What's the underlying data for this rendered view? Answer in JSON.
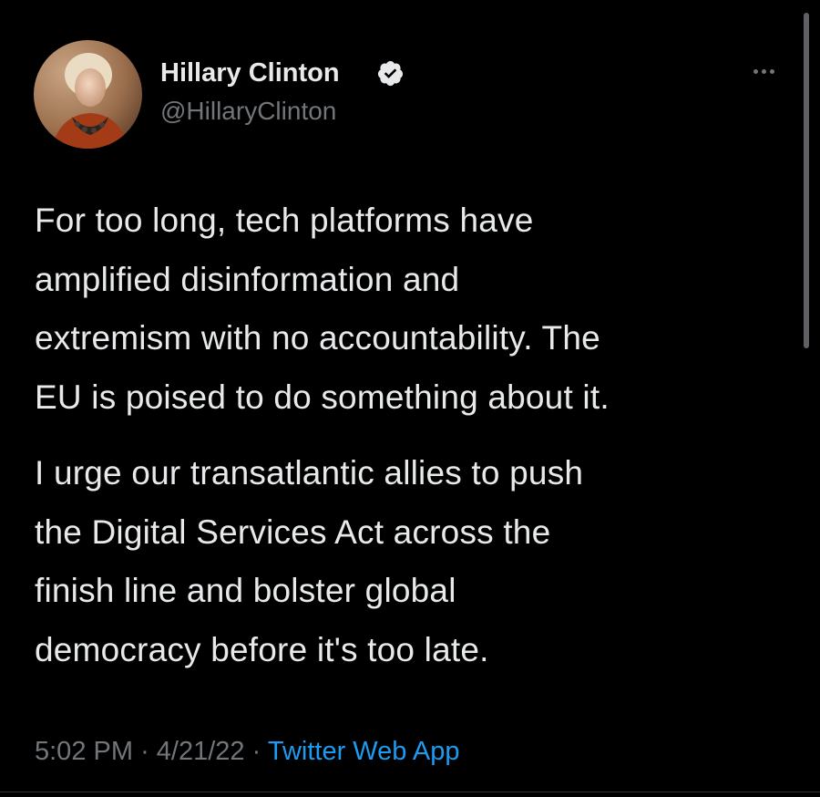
{
  "tweet": {
    "author": {
      "name": "Hillary Clinton",
      "handle": "@HillaryClinton",
      "verified": true
    },
    "paragraphs": [
      [
        "For too long, tech platforms have",
        "amplified disinformation and",
        "extremism with no accountability. The",
        "EU is poised to do something about it."
      ],
      [
        "I urge our transatlantic allies to push",
        "the Digital Services Act across the",
        "finish line and bolster global",
        "democracy before it's too late."
      ]
    ],
    "time": "5:02 PM",
    "date": "4/21/22",
    "separator": "·",
    "source": "Twitter Web App"
  },
  "icons": {
    "verified": "verified-badge-icon",
    "more": "more-options-icon"
  },
  "colors": {
    "background": "#000000",
    "text": "#e7e9ea",
    "secondary": "#71767b",
    "link": "#1d9bf0"
  }
}
